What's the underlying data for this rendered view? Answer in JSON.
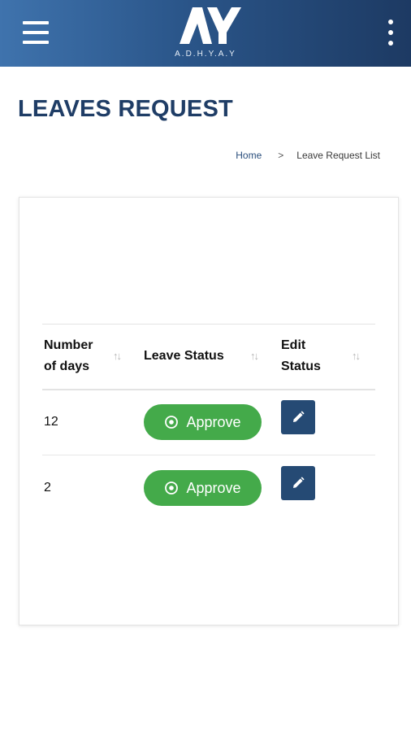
{
  "header": {
    "logo_text": "A.D.H.Y.A.Y",
    "menu_icon": "hamburger-menu-icon",
    "more_icon": "more-vertical-icon"
  },
  "page": {
    "title": "LEAVES REQUEST"
  },
  "breadcrumb": {
    "home": "Home",
    "separator": ">",
    "current": "Leave Request List"
  },
  "table": {
    "columns": [
      {
        "line1": "Number",
        "line2": "of days"
      },
      {
        "line1": "Leave Status",
        "line2": ""
      },
      {
        "line1": "Edit",
        "line2": "Status"
      }
    ],
    "sort_icon": "↑↓",
    "rows": [
      {
        "days": "12",
        "status_label": "Approve"
      },
      {
        "days": "2",
        "status_label": "Approve"
      }
    ]
  },
  "colors": {
    "header_gradient_start": "#3f73ad",
    "header_gradient_end": "#1d3a63",
    "title": "#1f3d66",
    "approve": "#44aa4a",
    "edit": "#254a74"
  }
}
